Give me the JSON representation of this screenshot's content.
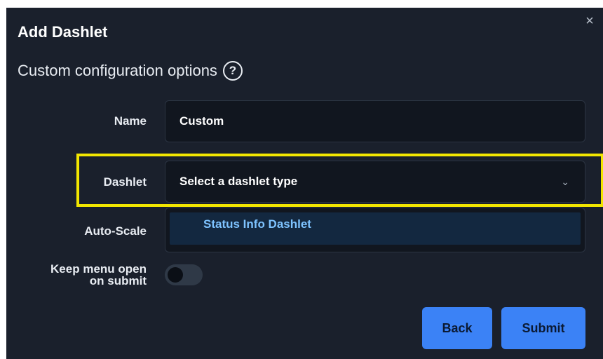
{
  "dialog": {
    "title": "Add Dashlet",
    "subtitle": "Custom configuration options",
    "help_icon": "?",
    "close_icon": "×"
  },
  "fields": {
    "name_label": "Name",
    "name_value": "Custom",
    "dashlet_label": "Dashlet",
    "dashlet_placeholder": "Select a dashlet type",
    "dashlet_chevron": "⌄",
    "autoscale_label": "Auto-Scale",
    "keep_open_label_line1": "Keep menu open",
    "keep_open_label_line2": "on submit",
    "keep_open_enabled": false
  },
  "dropdown": {
    "options": [
      "Status Info Dashlet"
    ]
  },
  "buttons": {
    "back": "Back",
    "submit": "Submit"
  },
  "colors": {
    "dialog_bg": "#1a202c",
    "accent": "#3b82f6",
    "highlight": "#f2e600"
  }
}
